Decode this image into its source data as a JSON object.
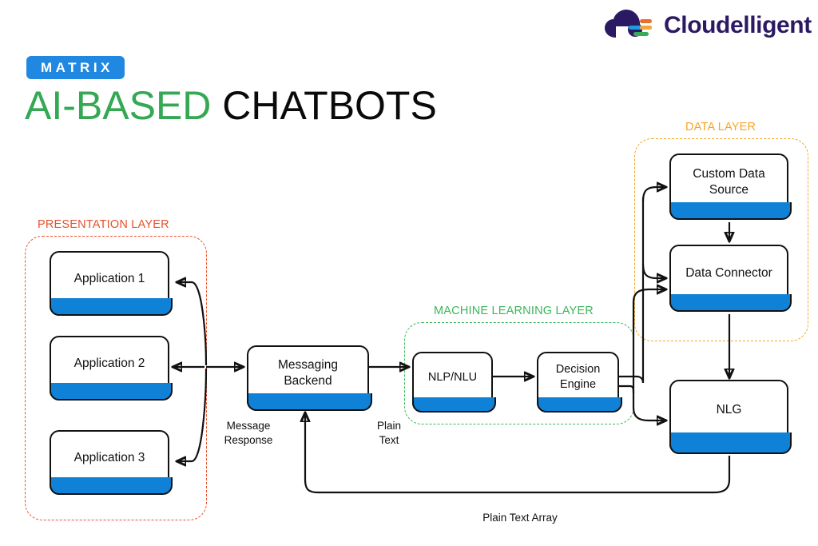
{
  "brand": {
    "name": "Cloudelligent",
    "logo_icon": "cloud-logo-icon",
    "wordmark_color": "#2b1a63",
    "accent_orange": "#e8702a",
    "accent_blue": "#1a9ee0",
    "accent_green": "#3aab55"
  },
  "header": {
    "badge": "MATRIX",
    "badge_color": "#2088e0",
    "title_highlight": "AI-BASED",
    "title_rest": " CHATBOTS",
    "title_highlight_color": "#34a853",
    "title_rest_color": "#0a0a0a"
  },
  "layers": [
    {
      "id": "presentation",
      "label": "PRESENTATION LAYER",
      "color": "#e8502d"
    },
    {
      "id": "machine-learning",
      "label": "MACHINE LEARNING LAYER",
      "color": "#3cb65c"
    },
    {
      "id": "data",
      "label": "DATA LAYER",
      "color": "#f7a623"
    }
  ],
  "nodes": [
    {
      "id": "application-1",
      "label": "Application 1"
    },
    {
      "id": "application-2",
      "label": "Application 2"
    },
    {
      "id": "application-3",
      "label": "Application 3"
    },
    {
      "id": "messaging-backend",
      "label": "Messaging\nBackend"
    },
    {
      "id": "nlp-nlu",
      "label": "NLP/NLU"
    },
    {
      "id": "decision-engine",
      "label": "Decision\nEngine"
    },
    {
      "id": "custom-data-source",
      "label": "Custom Data\nSource"
    },
    {
      "id": "data-connector",
      "label": "Data Connector"
    },
    {
      "id": "nlg",
      "label": "NLG"
    }
  ],
  "edge_labels": [
    {
      "id": "message-response",
      "text": "Message\nResponse"
    },
    {
      "id": "plain-text",
      "text": "Plain\nText"
    },
    {
      "id": "plain-text-array",
      "text": "Plain Text Array"
    }
  ],
  "style": {
    "node_bar_color": "#0f82d8",
    "node_border_color": "#111111",
    "connector_color": "#111111"
  }
}
